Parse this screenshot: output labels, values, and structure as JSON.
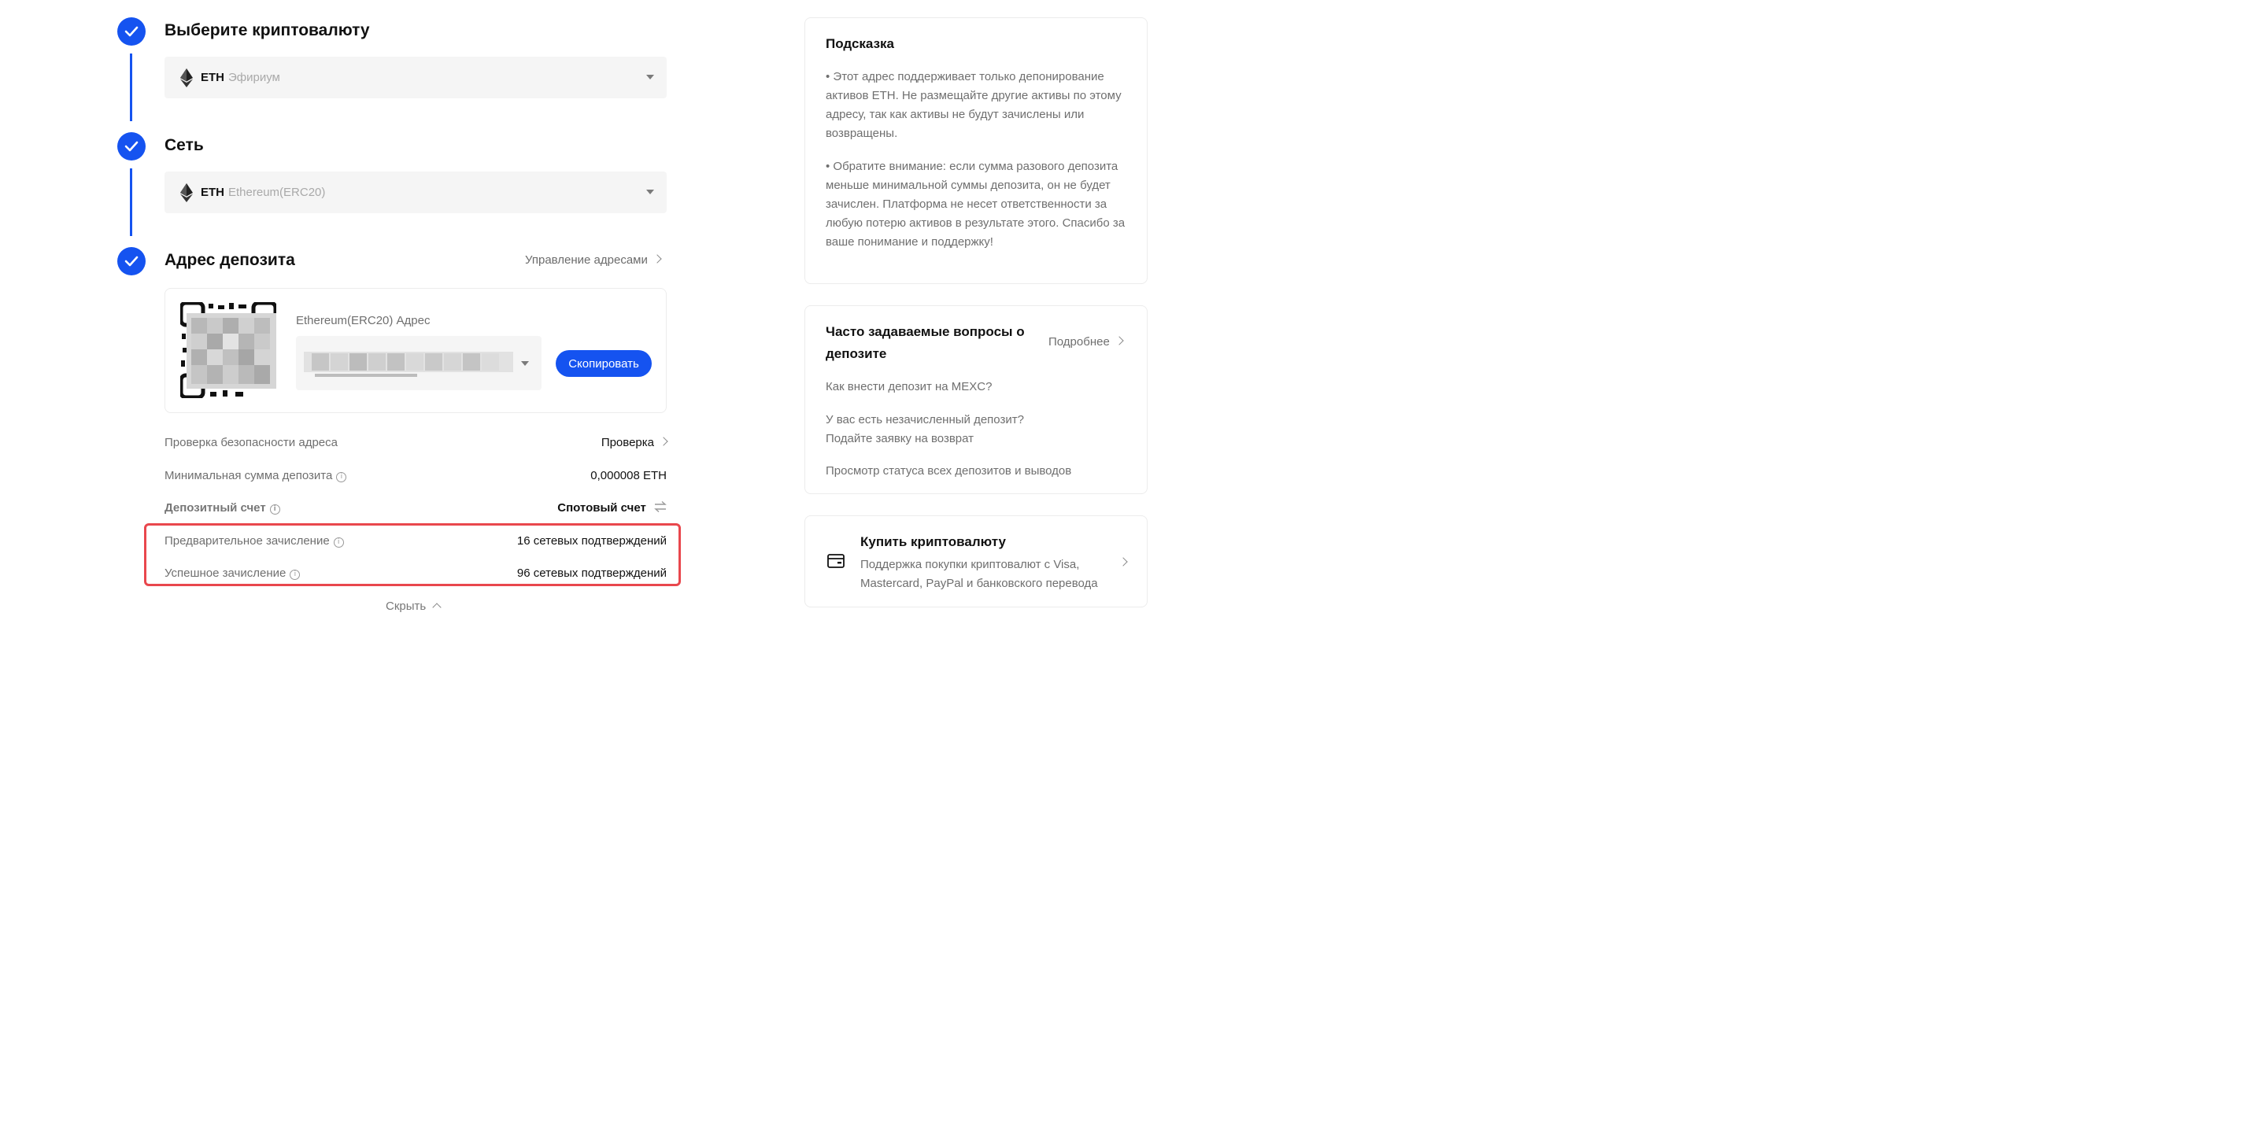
{
  "steps": {
    "currency": {
      "title": "Выберите криптовалюту",
      "coin": "ETH",
      "coin_name": "Эфириум"
    },
    "network": {
      "title": "Сеть",
      "coin": "ETH",
      "network_name": "Ethereum(ERC20)"
    },
    "address": {
      "title": "Адрес депозита",
      "manage_link": "Управление адресами",
      "address_label": "Ethereum(ERC20) Адрес",
      "copy_button": "Скопировать"
    }
  },
  "details": {
    "security_check": {
      "label": "Проверка безопасности адреса",
      "value": "Проверка"
    },
    "min_deposit": {
      "label": "Минимальная сумма депозита",
      "value": "0,000008 ETH"
    },
    "deposit_account": {
      "label": "Депозитный счет",
      "value": "Спотовый счет"
    },
    "pre_credit": {
      "label": "Предварительное зачисление",
      "value": "16 сетевых подтверждений"
    },
    "success_credit": {
      "label": "Успешное зачисление",
      "value": "96 сетевых подтверждений"
    },
    "hide": "Скрыть"
  },
  "tips": {
    "title": "Подсказка",
    "p1": "• Этот адрес поддерживает только депонирование активов ETH. Не размещайте другие активы по этому адресу, так как активы не будут зачислены или возвращены.",
    "p2": "• Обратите внимание: если сумма разового депозита меньше минимальной суммы депозита, он не будет зачислен. Платформа не несет ответственности за любую потерю активов в результате этого. Спасибо за ваше понимание и поддержку!"
  },
  "faq": {
    "title": "Часто задаваемые вопросы о депозите",
    "more": "Подробнее",
    "items": [
      "Как внести депозит на MEXC?",
      "У вас есть незачисленный депозит? Подайте заявку на возврат",
      "Просмотр статуса всех депозитов и выводов"
    ]
  },
  "buy": {
    "title": "Купить криптовалюту",
    "text": "Поддержка покупки криптовалют с Visa, Mastercard, PayPal и банковского перевода"
  },
  "colors": {
    "accent": "#1553f0",
    "highlight": "#e9474d"
  }
}
